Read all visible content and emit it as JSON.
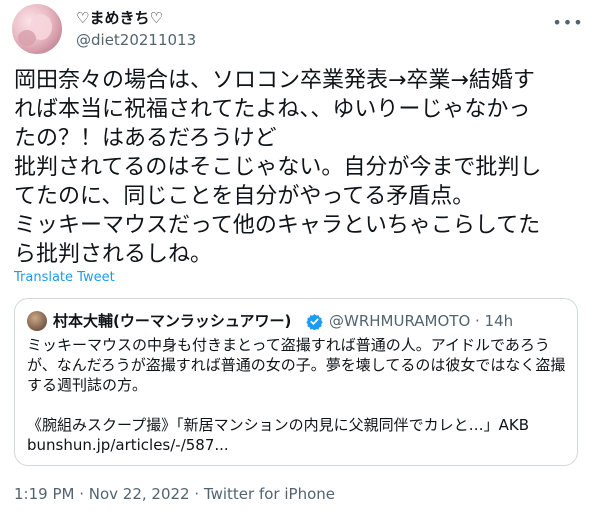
{
  "author": {
    "display_name": "♡まめきち♡",
    "handle": "@diet20211013"
  },
  "more_icon": "more-horizontal-icon",
  "tweet": {
    "lines": [
      "岡田奈々の場合は、ソロコン卒業発表→卒業→結婚す",
      "れば本当に祝福されてたよね、、ゆいりーじゃなかっ",
      "たの？！はあるだろうけど",
      "批判されてるのはそこじゃない。自分が今まで批判し",
      "てたのに、同じことを自分がやってる矛盾点。",
      "ミッキーマウスだって他のキャラといちゃこらしてた",
      "ら批判されるしね。"
    ],
    "translate_label": "Translate Tweet"
  },
  "quote": {
    "display_name": "村本大輔(ウーマンラッシュアワー)",
    "handle_time": "@WRHMURAMOTO · 14h",
    "verified_color": "#1d9bf0",
    "lines": [
      "ミッキーマウスの中身も付きまとって盗撮すれば普通の人。アイドルであろう",
      "が、なんだろうが盗撮すれば普通の女の子。夢を壊してるのは彼女ではなく盗撮",
      "する週刊誌の方。",
      "",
      "《腕組みスクープ撮》「新居マンションの内見に父親同伴でカレと…」AKB",
      "bunshun.jp/articles/-/587..."
    ]
  },
  "meta": {
    "time": "1:19 PM",
    "separator1": " · ",
    "date": "Nov 22, 2022",
    "separator2": " · ",
    "source": "Twitter for iPhone"
  },
  "colors": {
    "link": "#1d9bf0",
    "secondary": "#536471",
    "border": "#cfd9de"
  }
}
